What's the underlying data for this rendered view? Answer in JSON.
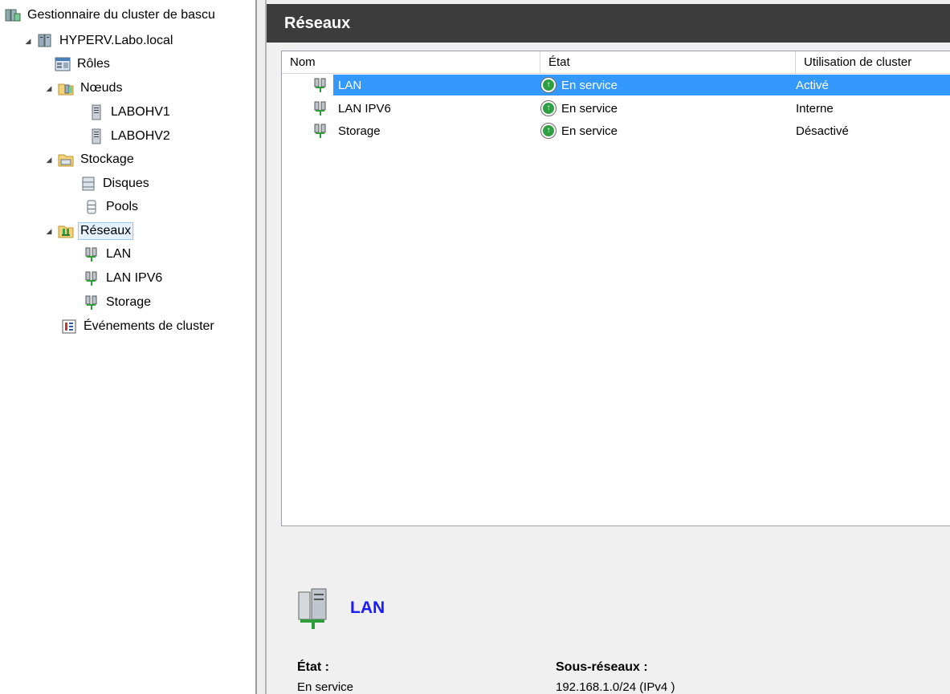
{
  "tree": {
    "root_label": "Gestionnaire du cluster de bascu",
    "cluster_label": "HYPERV.Labo.local",
    "roles_label": "Rôles",
    "nodes_label": "Nœuds",
    "node1_label": "LABOHV1",
    "node2_label": "LABOHV2",
    "storage_label": "Stockage",
    "disks_label": "Disques",
    "pools_label": "Pools",
    "networks_label": "Réseaux",
    "net1_label": "LAN",
    "net2_label": "LAN IPV6",
    "net3_label": "Storage",
    "events_label": "Événements de cluster"
  },
  "main": {
    "title": "Réseaux",
    "columns": {
      "name": "Nom",
      "state": "État",
      "usage": "Utilisation de cluster"
    },
    "rows": [
      {
        "name": "LAN",
        "state": "En service",
        "usage": "Activé",
        "selected": true
      },
      {
        "name": "LAN IPV6",
        "state": "En service",
        "usage": "Interne",
        "selected": false
      },
      {
        "name": "Storage",
        "state": "En service",
        "usage": "Désactivé",
        "selected": false
      }
    ]
  },
  "details": {
    "title": "LAN",
    "state_label": "État :",
    "state_value": "En service",
    "subnets_label": "Sous-réseaux :",
    "subnets_value": "192.168.1.0/24 (IPv4 )"
  },
  "colors": {
    "header_bg": "#3c3c3c",
    "selection": "#3399ff",
    "status_ok": "#2ea043",
    "detail_title": "#1a1aff"
  },
  "icons": {
    "cluster_manager": "cluster-manager-icon",
    "cluster": "cluster-icon",
    "roles": "roles-icon",
    "nodes": "nodes-icon",
    "server": "server-icon",
    "storage": "storage-folder-icon",
    "disks": "disks-icon",
    "pools": "pools-icon",
    "network": "network-icon",
    "events": "events-icon",
    "status_up": "status-up-icon"
  }
}
